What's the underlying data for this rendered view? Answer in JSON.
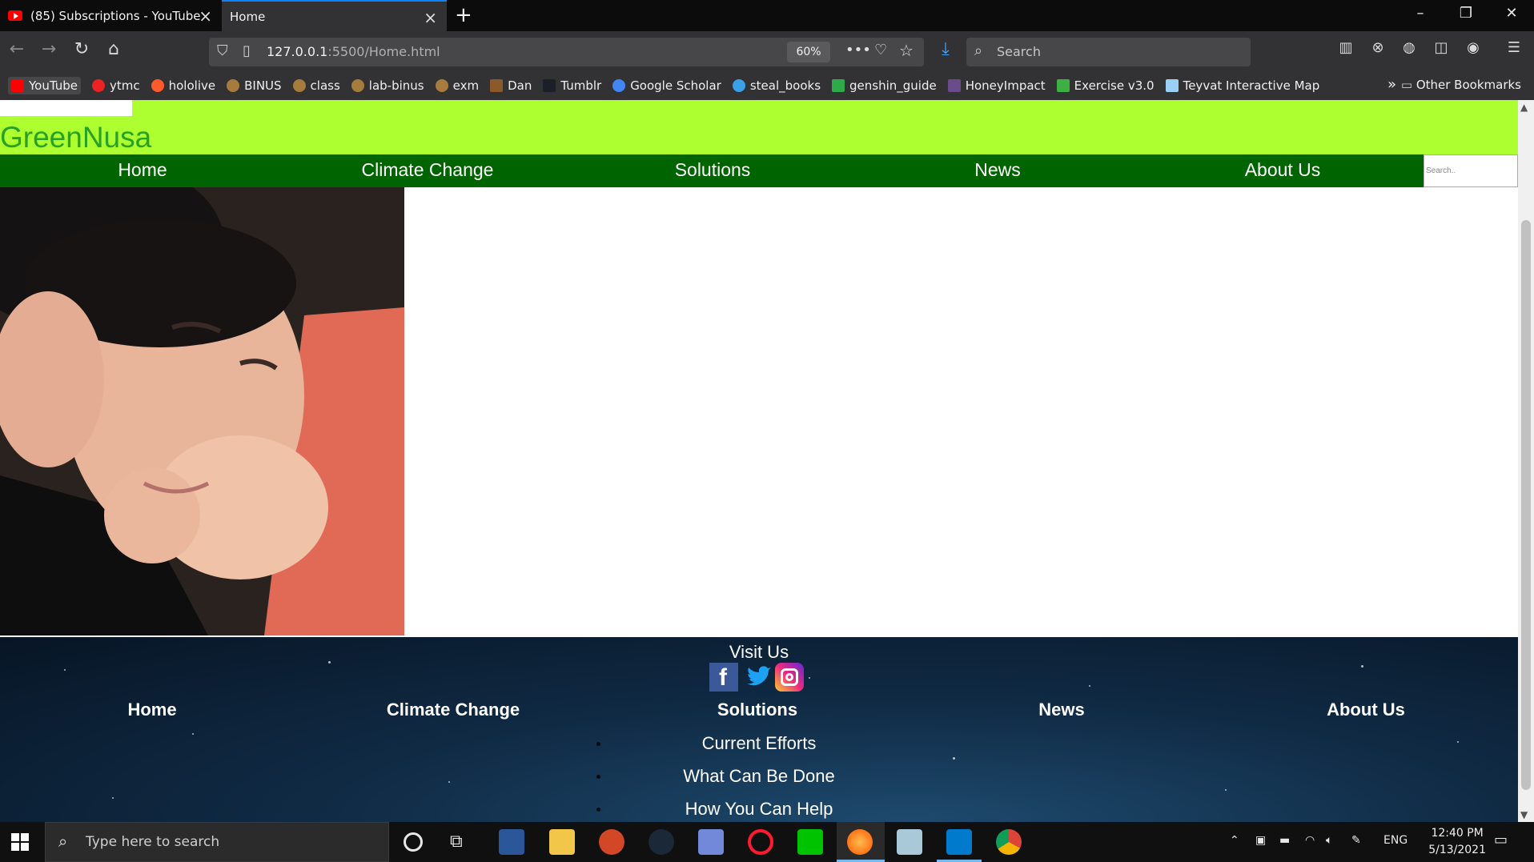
{
  "browser": {
    "tabs": [
      {
        "label": "(85) Subscriptions - YouTube",
        "active": false
      },
      {
        "label": "Home",
        "active": true
      }
    ],
    "url_host": "127.0.0.1",
    "url_path": ":5500/Home.html",
    "zoom": "60%",
    "search_placeholder": "Search",
    "bookmarks": [
      "YouTube",
      "ytmc",
      "hololive",
      "BINUS",
      "class",
      "lab-binus",
      "exm",
      "Dan",
      "Tumblr",
      "Google Scholar",
      "steal_books",
      "genshin_guide",
      "HoneyImpact",
      "Exercise v3.0",
      "Teyvat Interactive Map"
    ],
    "other_bookmarks": "Other Bookmarks"
  },
  "site": {
    "logo": "GreenNusa",
    "nav": [
      "Home",
      "Climate Change",
      "Solutions",
      "News",
      "About Us"
    ],
    "search_placeholder": "Search..",
    "footer": {
      "visit_us": "Visit Us",
      "columns": [
        "Home",
        "Climate Change",
        "Solutions",
        "News",
        "About Us"
      ],
      "solutions_links": [
        "Current Efforts",
        "What Can Be Done",
        "How You Can Help"
      ]
    }
  },
  "taskbar": {
    "search_placeholder": "Type here to search",
    "language": "ENG",
    "time": "12:40 PM",
    "date": "5/13/2021"
  }
}
